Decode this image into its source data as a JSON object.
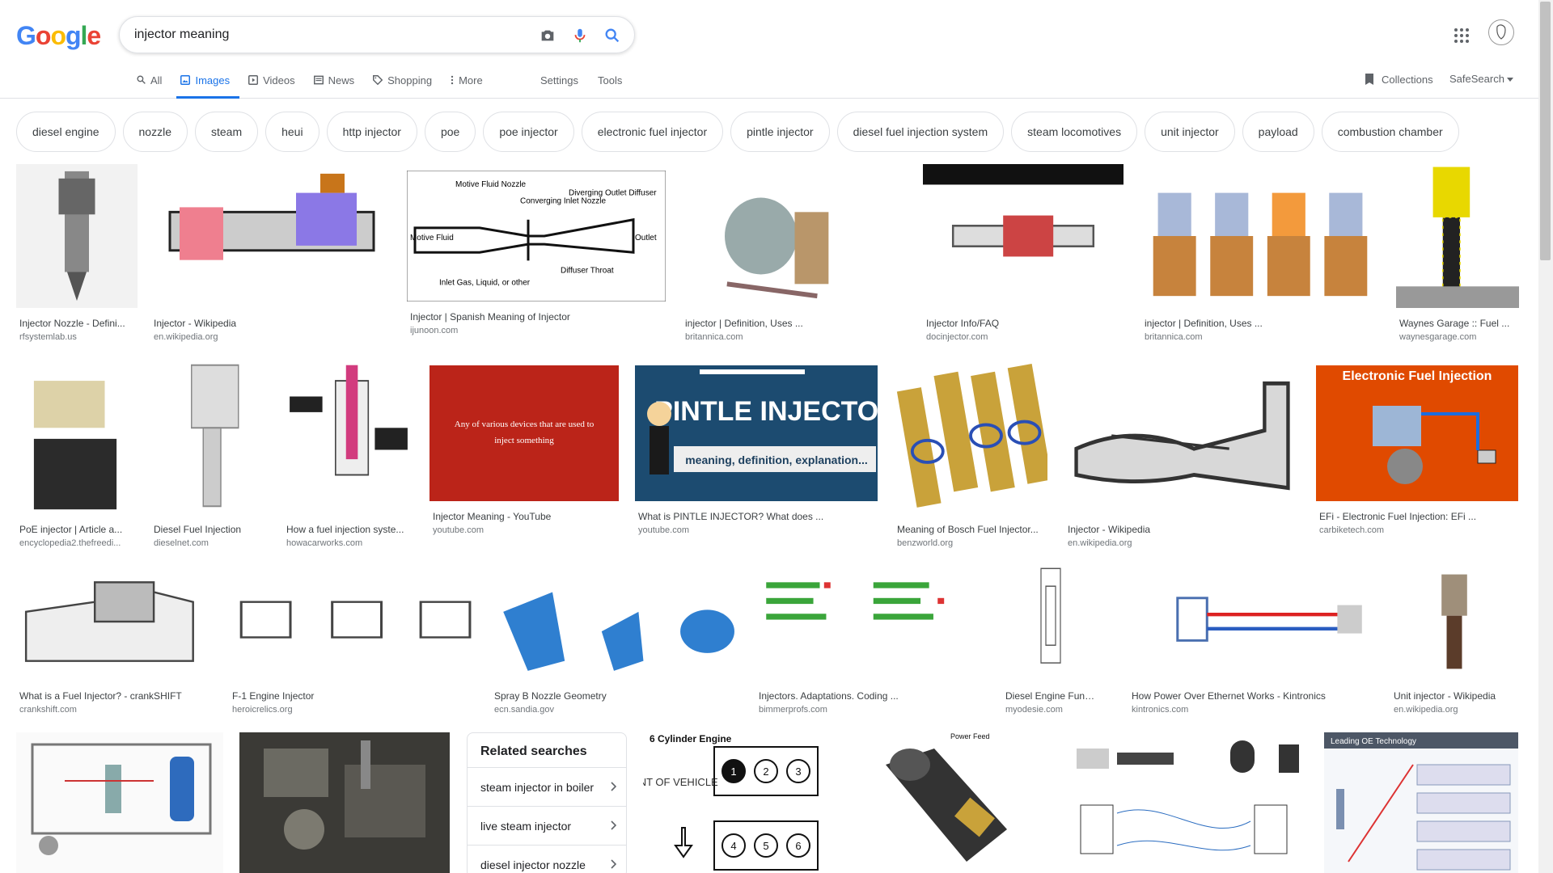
{
  "logo": {
    "letters": [
      "G",
      "o",
      "o",
      "g",
      "l",
      "e"
    ],
    "colors": [
      "#4285F4",
      "#EA4335",
      "#FBBC05",
      "#4285F4",
      "#34A853",
      "#EA4335"
    ]
  },
  "search": {
    "query": "injector meaning"
  },
  "tabs": [
    {
      "label": "All",
      "icon": "search-icon",
      "active": false
    },
    {
      "label": "Images",
      "icon": "image-icon",
      "active": true
    },
    {
      "label": "Videos",
      "icon": "video-icon",
      "active": false
    },
    {
      "label": "News",
      "icon": "news-icon",
      "active": false
    },
    {
      "label": "Shopping",
      "icon": "tag-icon",
      "active": false
    },
    {
      "label": "More",
      "icon": "more-vert-icon",
      "active": false
    }
  ],
  "settings_label": "Settings",
  "tools_label": "Tools",
  "collections_label": "Collections",
  "safesearch_label": "SafeSearch",
  "chips": [
    "diesel engine",
    "nozzle",
    "steam",
    "heui",
    "http injector",
    "poe",
    "poe injector",
    "electronic fuel injector",
    "pintle injector",
    "diesel fuel injection system",
    "steam locomotives",
    "unit injector",
    "payload",
    "combustion chamber"
  ],
  "results": [
    {
      "caption": "Injector Nozzle - Defini...",
      "source": "rfsystemlab.us"
    },
    {
      "caption": "Injector - Wikipedia",
      "source": "en.wikipedia.org"
    },
    {
      "caption": "Injector | Spanish Meaning of Injector",
      "source": "ijunoon.com"
    },
    {
      "caption": "injector | Definition, Uses ...",
      "source": "britannica.com"
    },
    {
      "caption": "Injector Info/FAQ",
      "source": "docinjector.com"
    },
    {
      "caption": "injector | Definition, Uses ...",
      "source": "britannica.com"
    },
    {
      "caption": "Waynes Garage :: Fuel ...",
      "source": "waynesgarage.com"
    },
    {
      "caption": "PoE injector | Article a...",
      "source": "encyclopedia2.thefreedi..."
    },
    {
      "caption": "Diesel Fuel Injection",
      "source": "dieselnet.com"
    },
    {
      "caption": "How a fuel injection syste...",
      "source": "howacarworks.com"
    },
    {
      "caption": "Injector Meaning - YouTube",
      "source": "youtube.com"
    },
    {
      "caption": "What is PINTLE INJECTOR? What does ...",
      "source": "youtube.com"
    },
    {
      "caption": "Meaning of Bosch Fuel Injector...",
      "source": "benzworld.org"
    },
    {
      "caption": "Injector - Wikipedia",
      "source": "en.wikipedia.org"
    },
    {
      "caption": "EFi - Electronic Fuel Injection: EFi ...",
      "source": "carbiketech.com"
    },
    {
      "caption": "What is a Fuel Injector? - crankSHIFT",
      "source": "crankshift.com"
    },
    {
      "caption": "F-1 Engine Injector",
      "source": "heroicrelics.org"
    },
    {
      "caption": "Spray B Nozzle Geometry",
      "source": "ecn.sandia.gov"
    },
    {
      "caption": "Injectors. Adaptations. Coding ...",
      "source": "bimmerprofs.com"
    },
    {
      "caption": "Diesel Engine Fundame...",
      "source": "myodesie.com"
    },
    {
      "caption": "How Power Over Ethernet Works - Kintronics",
      "source": "kintronics.com"
    },
    {
      "caption": "Unit injector - Wikipedia",
      "source": "en.wikipedia.org"
    }
  ],
  "thumb_text": {
    "youtube_red": "Any of various devices that are used to inject something",
    "pintle_title": "PINTLE INJECTOR",
    "pintle_sub": "meaning, definition, explanation...",
    "efi_title": "Electronic Fuel Injection",
    "six_cyl_title": "6 Cylinder Engine",
    "six_cyl_front": "FRONT OF VEHICLE",
    "six_cyl_nums": [
      "1",
      "2",
      "3",
      "4",
      "5",
      "6"
    ],
    "oe_title": "Leading OE Technology",
    "power_feed": "Power Feed",
    "steam_labels": [
      "Motive Fluid Nozzle",
      "Converging Inlet Nozzle",
      "Diverging Outlet Diffuser",
      "Outlet",
      "Diffuser Throat",
      "Inlet Gas, Liquid, or other",
      "Motive Fluid"
    ]
  },
  "related": {
    "title": "Related searches",
    "items": [
      "steam injector in boiler",
      "live steam injector",
      "diesel injector nozzle"
    ]
  }
}
